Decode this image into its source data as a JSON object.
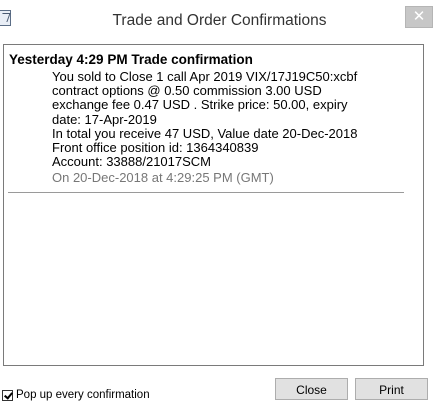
{
  "window": {
    "title": "Trade and Order Confirmations",
    "close_glyph": "✕"
  },
  "confirmation": {
    "heading": "Yesterday 4:29 PM Trade confirmation",
    "lines": [
      "You sold to Close 1 call Apr 2019 VIX/17J19C50:xcbf",
      "contract options @ 0.50 commission 3.00 USD",
      "exchange fee 0.47 USD . Strike price: 50.00, expiry",
      "date: 17-Apr-2019",
      "In total you receive 47 USD, Value date 20-Dec-2018",
      "Front office position id: 1364340839",
      "Account: 33888/21017SCM"
    ],
    "timestamp": "On 20-Dec-2018 at 4:29:25 PM (GMT)"
  },
  "footer": {
    "popup_label": "Pop up every confirmation",
    "popup_checked": true,
    "close_label": "Close",
    "print_label": "Print"
  }
}
